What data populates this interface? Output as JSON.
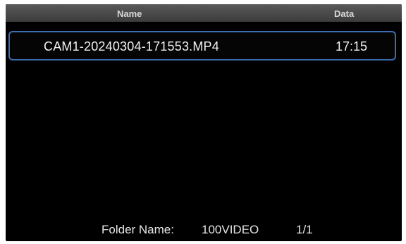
{
  "header": {
    "name_label": "Name",
    "date_label": "Data"
  },
  "files": [
    {
      "name": "CAM1-20240304-171553.MP4",
      "time": "17:15",
      "selected": true
    }
  ],
  "footer": {
    "folder_label": "Folder Name:",
    "folder_name": "100VIDEO",
    "page": "1/1"
  },
  "colors": {
    "background": "#000000",
    "header": "#4a4a4a",
    "selection_border": "#3b6fb0",
    "text": "#f2f2f2"
  }
}
